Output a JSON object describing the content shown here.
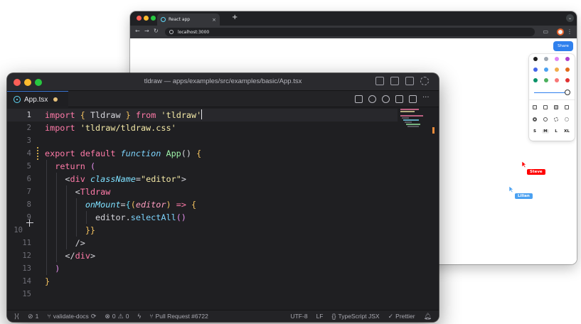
{
  "browser": {
    "tab_title": "React app",
    "tab_close": "×",
    "new_tab": "+",
    "menu": "⌄",
    "url": "localhost:3000",
    "nav_back": "←",
    "nav_forward": "→",
    "nav_reload": "↻",
    "more": "⋮",
    "share_label": "Share",
    "colors": [
      "#1d1d1d",
      "#9fa8b2",
      "#e085f4",
      "#ae3ec9",
      "#4465e9",
      "#4ba1f1",
      "#f1ac4b",
      "#e16919",
      "#099268",
      "#4cb05e",
      "#f87777",
      "#e03131"
    ],
    "sizes": [
      "S",
      "M",
      "L",
      "XL"
    ],
    "cursors": [
      {
        "name": "Steve",
        "color": "#ff0000"
      },
      {
        "name": "Lilian",
        "color": "#4ba1f1"
      }
    ]
  },
  "editor": {
    "window_title": "tldraw — apps/examples/src/examples/basic/App.tsx",
    "tab_label": "App.tsx",
    "line_numbers": [
      "1",
      "2",
      "3",
      "4",
      "5",
      "6",
      "7",
      "8",
      "9",
      "10",
      "11",
      "12",
      "13",
      "14",
      "15"
    ],
    "code": {
      "l1_import": "import",
      "l1_brace_open": "{",
      "l1_name": " Tldraw ",
      "l1_brace_close": "}",
      "l1_from": " from ",
      "l1_src": "'tldraw'",
      "l2_import": "import",
      "l2_src": " 'tldraw/tldraw.css'",
      "l4_export": "export",
      "l4_default": " default ",
      "l4_function": "function",
      "l4_name": " App",
      "l4_parens": "() ",
      "l4_brace": "{",
      "l5_return": "return",
      "l5_paren": " (",
      "l6_open": "<",
      "l6_tag": "div",
      "l6_attr": " className",
      "l6_eq": "=",
      "l6_val": "\"editor\"",
      "l6_close": ">",
      "l7_open": "<",
      "l7_tag": "Tldraw",
      "l8_attr": "onMount",
      "l8_eq": "=",
      "l8_brace": "{",
      "l8_paren_open": "(",
      "l8_param": "editor",
      "l8_paren_close": ")",
      "l8_arrow": " => ",
      "l8_brace2": "{",
      "l9_obj": "editor",
      "l9_dot": ".",
      "l9_fn": "selectAll",
      "l9_call": "()",
      "l10_close": "}}",
      "l11_close": "/>",
      "l12_open": "</",
      "l12_tag": "div",
      "l12_close": ">",
      "l13_paren": ")",
      "l14_brace": "}"
    },
    "status": {
      "ports": "1",
      "branch": "validate-docs",
      "errors": "0",
      "warnings": "0",
      "pull_request": "Pull Request #6722",
      "encoding": "UTF-8",
      "eol": "LF",
      "language": "TypeScript JSX",
      "formatter": "Prettier"
    }
  }
}
